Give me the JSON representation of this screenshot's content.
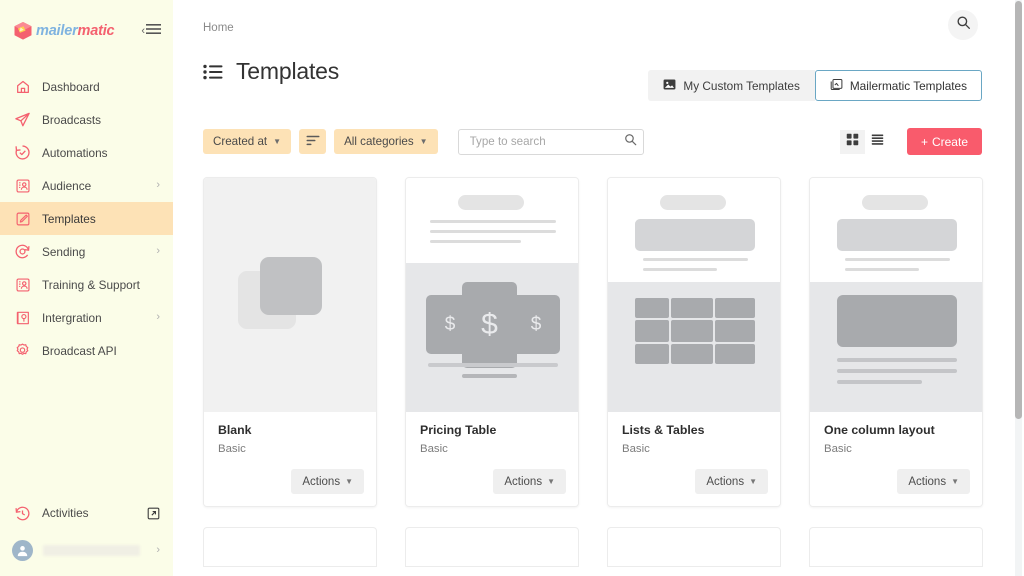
{
  "brand": {
    "name_part1": "mailer",
    "name_part2": "matic",
    "color_blue": "#7fb3e0",
    "color_red": "#f4616f",
    "accent_peach": "#fde2b6",
    "sidebar_bg": "#fbfde8",
    "primary_button": "#f95b6c",
    "active_outline": "#6aa7c4"
  },
  "sidebar": {
    "collapse_label": "collapse",
    "items": [
      {
        "label": "Dashboard",
        "icon": "home-icon",
        "has_chevron": false,
        "active": false
      },
      {
        "label": "Broadcasts",
        "icon": "paper-plane-icon",
        "has_chevron": false,
        "active": false
      },
      {
        "label": "Automations",
        "icon": "clock-check-icon",
        "has_chevron": false,
        "active": false
      },
      {
        "label": "Audience",
        "icon": "audience-icon",
        "has_chevron": true,
        "active": false
      },
      {
        "label": "Templates",
        "icon": "template-edit-icon",
        "has_chevron": false,
        "active": true
      },
      {
        "label": "Sending",
        "icon": "sending-icon",
        "has_chevron": true,
        "active": false
      },
      {
        "label": "Training & Support",
        "icon": "training-icon",
        "has_chevron": false,
        "active": false
      },
      {
        "label": "Intergration",
        "icon": "integration-icon",
        "has_chevron": true,
        "active": false
      },
      {
        "label": "Broadcast API",
        "icon": "api-gear-icon",
        "has_chevron": false,
        "active": false
      }
    ],
    "bottom": {
      "activities_label": "Activities",
      "activities_icon": "history-icon",
      "external_icon": "external-link-icon",
      "user_name": "",
      "user_chevron": "›"
    }
  },
  "header": {
    "breadcrumb": "Home",
    "page_title": "Templates",
    "title_icon": "list-icon",
    "search_icon": "search-icon"
  },
  "segmented": {
    "options": [
      {
        "label": "My Custom Templates",
        "icon": "image-icon",
        "active": false
      },
      {
        "label": "Mailermatic Templates",
        "icon": "copy-icon",
        "active": true
      }
    ]
  },
  "toolbar": {
    "sort_label": "Created at",
    "sort_direction_icon": "sort-desc-icon",
    "category_label": "All categories",
    "search_placeholder": "Type to search",
    "search_value": "",
    "search_icon": "search-icon",
    "view_grid_icon": "grid-view-icon",
    "view_list_icon": "list-view-icon",
    "view_active": "list",
    "create_label": "Create",
    "create_prefix": "+"
  },
  "cards": {
    "actions_label": "Actions",
    "items": [
      {
        "title": "Blank",
        "subtitle": "Basic",
        "thumb": "blank"
      },
      {
        "title": "Pricing Table",
        "subtitle": "Basic",
        "thumb": "pricing"
      },
      {
        "title": "Lists & Tables",
        "subtitle": "Basic",
        "thumb": "table"
      },
      {
        "title": "One column layout",
        "subtitle": "Basic",
        "thumb": "onecol"
      }
    ]
  },
  "pricing_symbols": {
    "left": "$",
    "center": "$",
    "right": "$"
  }
}
